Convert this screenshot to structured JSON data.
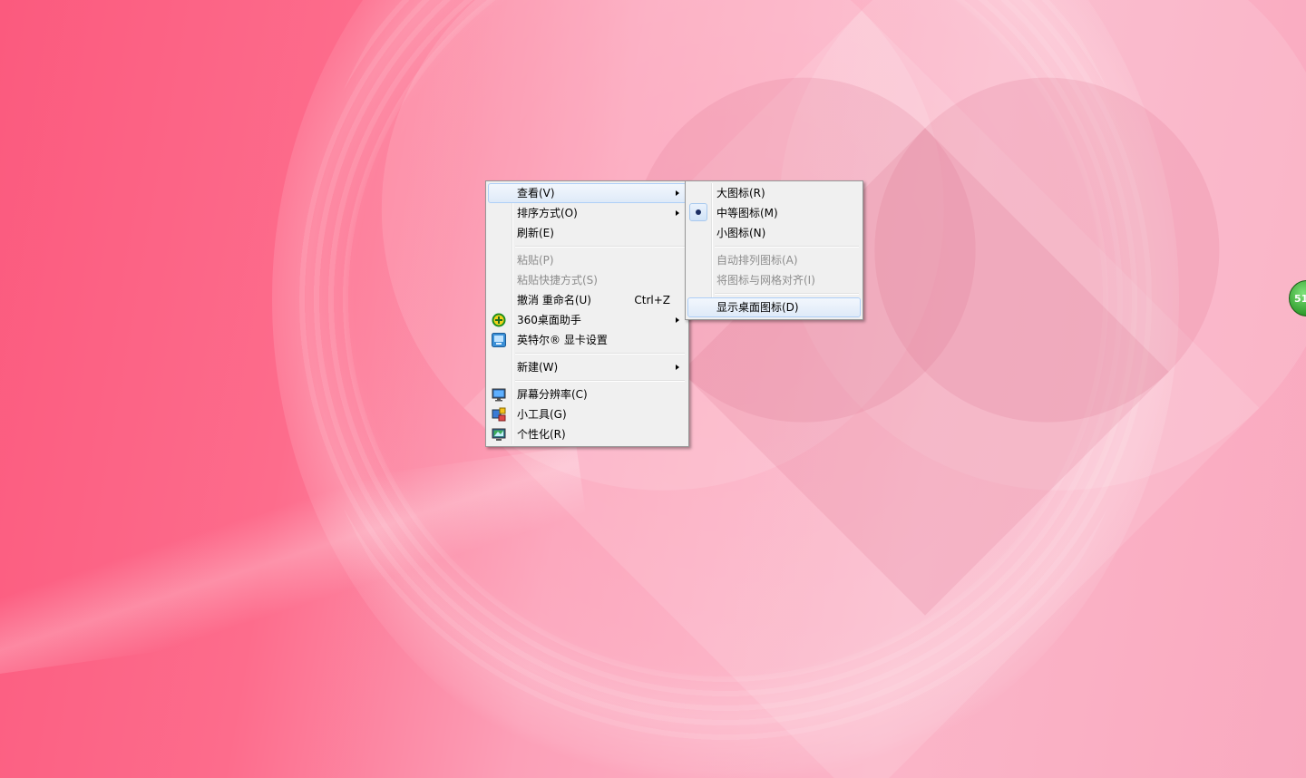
{
  "main_menu": {
    "items": [
      {
        "label": "查看(V)",
        "submenu": true,
        "highlighted": true
      },
      {
        "label": "排序方式(O)",
        "submenu": true
      },
      {
        "label": "刷新(E)"
      },
      {
        "label": "粘贴(P)",
        "disabled": true
      },
      {
        "label": "粘贴快捷方式(S)",
        "disabled": true
      },
      {
        "label": "撤消 重命名(U)",
        "shortcut": "Ctrl+Z"
      },
      {
        "label": "360桌面助手",
        "submenu": true,
        "icon": "360-desktop-icon"
      },
      {
        "label": "英特尔® 显卡设置",
        "icon": "intel-graphics-icon"
      },
      {
        "label": "新建(W)",
        "submenu": true
      },
      {
        "label": "屏幕分辨率(C)",
        "icon": "monitor-icon"
      },
      {
        "label": "小工具(G)",
        "icon": "gadgets-icon"
      },
      {
        "label": "个性化(R)",
        "icon": "personalize-icon"
      }
    ]
  },
  "view_submenu": {
    "items": [
      {
        "label": "大图标(R)"
      },
      {
        "label": "中等图标(M)",
        "selected": true
      },
      {
        "label": "小图标(N)"
      },
      {
        "label": "自动排列图标(A)",
        "disabled": true
      },
      {
        "label": "将图标与网格对齐(I)",
        "disabled": true
      },
      {
        "label": "显示桌面图标(D)",
        "highlighted": true
      }
    ]
  },
  "gadget": {
    "label": "51"
  },
  "colors": {
    "accent_green": "#2e9b2b",
    "menu_bg": "#f0f0f0",
    "highlight_border": "#aecff7"
  }
}
